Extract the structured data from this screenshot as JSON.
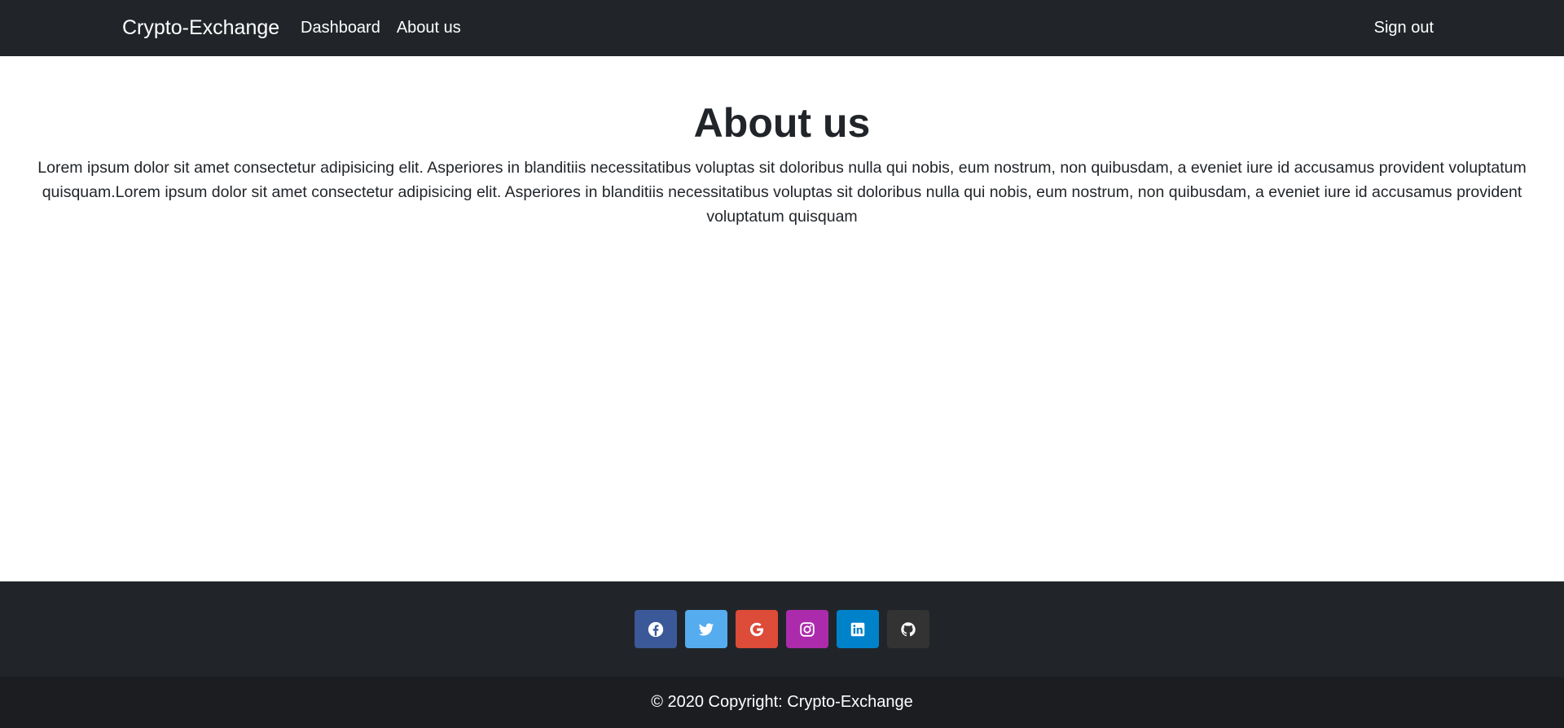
{
  "navbar": {
    "brand": "Crypto-Exchange",
    "links": [
      {
        "label": "Dashboard"
      },
      {
        "label": "About us"
      }
    ],
    "signout_label": "Sign out"
  },
  "main": {
    "title": "About us",
    "text": "Lorem ipsum dolor sit amet consectetur adipisicing elit. Asperiores in blanditiis necessitatibus voluptas sit doloribus nulla qui nobis, eum nostrum, non quibusdam, a eveniet iure id accusamus provident voluptatum quisquam.Lorem ipsum dolor sit amet consectetur adipisicing elit. Asperiores in blanditiis necessitatibus voluptas sit doloribus nulla qui nobis, eum nostrum, non quibusdam, a eveniet iure id accusamus provident voluptatum quisquam"
  },
  "footer": {
    "social": [
      {
        "icon": "facebook-icon",
        "color": "#3b5998"
      },
      {
        "icon": "twitter-icon",
        "color": "#55acee"
      },
      {
        "icon": "google-icon",
        "color": "#dd4b39"
      },
      {
        "icon": "instagram-icon",
        "color": "#ac2bac"
      },
      {
        "icon": "linkedin-icon",
        "color": "#0082ca"
      },
      {
        "icon": "github-icon",
        "color": "#333333"
      }
    ],
    "copyright": "© 2020 Copyright: Crypto-Exchange"
  }
}
